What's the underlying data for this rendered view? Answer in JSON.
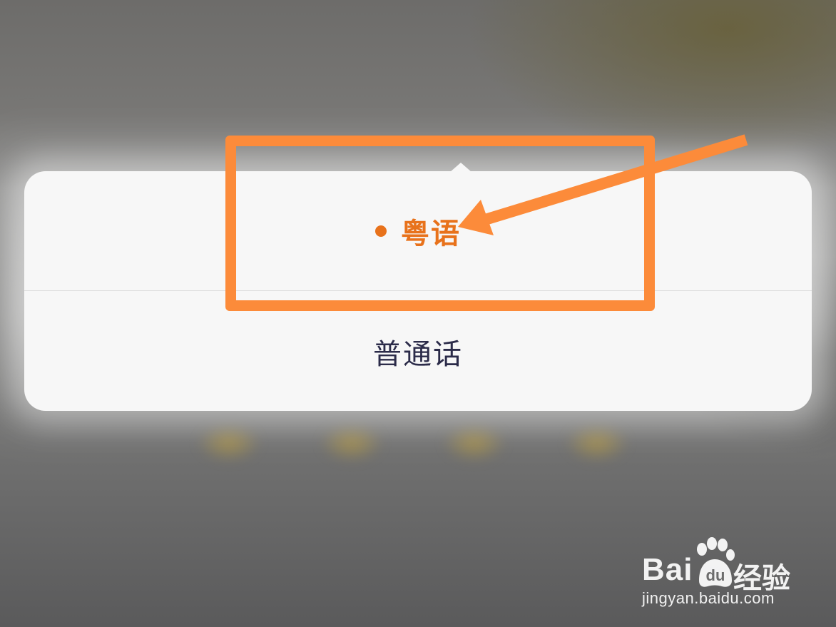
{
  "language_picker": {
    "options": [
      {
        "label": "粤语",
        "selected": true
      },
      {
        "label": "普通话",
        "selected": false
      }
    ],
    "selected_color": "#e8721b",
    "unselected_color": "#2b2b49"
  },
  "annotation": {
    "color": "#fc8b3a"
  },
  "watermark": {
    "brand_left": "Bai",
    "brand_right": "经验",
    "url": "jingyan.baidu.com"
  }
}
